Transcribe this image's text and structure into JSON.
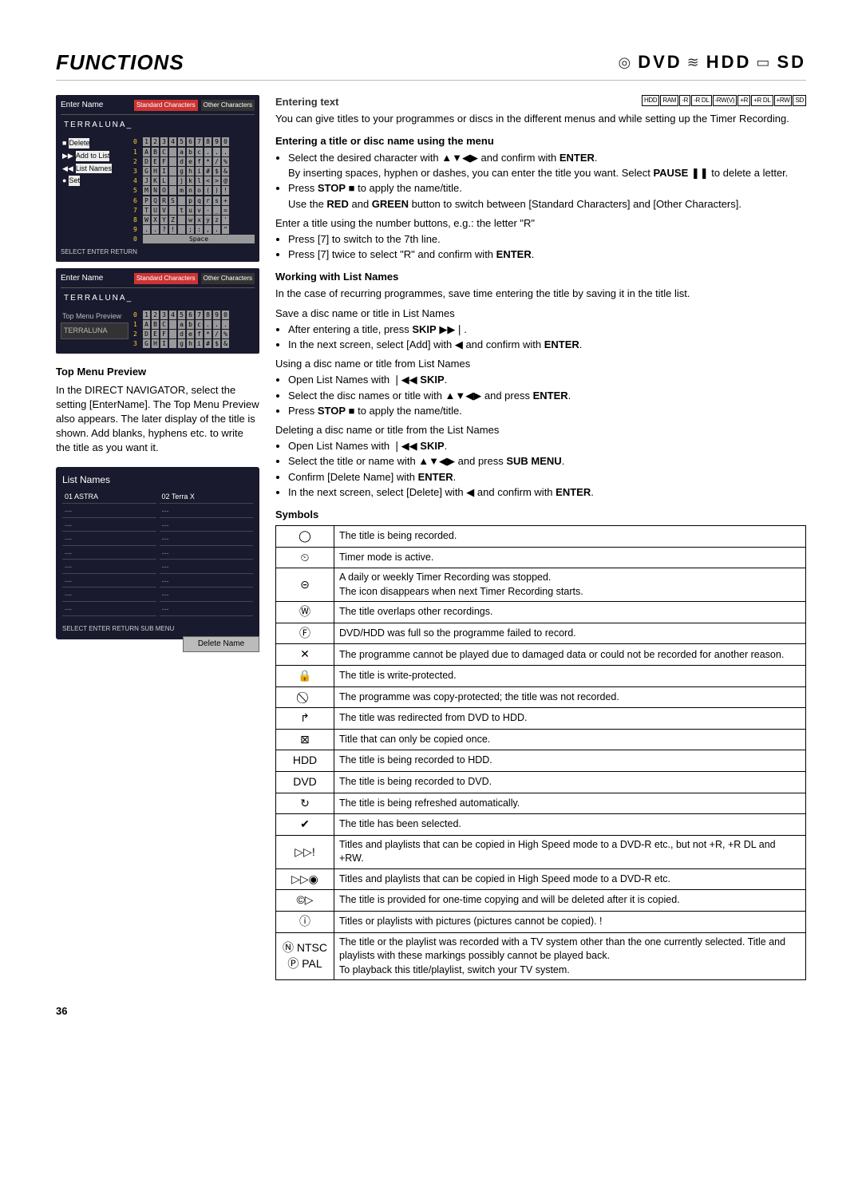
{
  "header": {
    "title": "FUNCTIONS",
    "media": [
      "DVD",
      "HDD",
      "SD"
    ]
  },
  "osd1": {
    "title": "Enter Name",
    "tab1": "Standard Characters",
    "tab2": "Other Characters",
    "sub": "TERRALUNA_",
    "menu": [
      "Delete",
      "Add to List",
      "List Names",
      "Set"
    ],
    "foot": "SELECT   ENTER   RETURN",
    "space": "Space"
  },
  "osd2": {
    "title": "Enter Name",
    "tab1": "Standard Characters",
    "tab2": "Other Characters",
    "sub": "TERRALUNA_",
    "pvlabel": "Top Menu Preview",
    "pv": "TERRALUNA"
  },
  "tmp_h": "Top Menu Preview",
  "tmp_p": "In the DIRECT NAVIGATOR, select the setting [EnterName]. The Top Menu Preview also appears. The later display of the title is shown. Add blanks, hyphens etc. to write the title as you want it.",
  "list": {
    "title": "List Names",
    "items": [
      "01 ASTRA",
      "02 Terra X",
      "---",
      "---",
      "---",
      "---",
      "---",
      "---",
      "---",
      "---",
      "---",
      "---",
      "---",
      "---",
      "---",
      "---",
      "---",
      "---"
    ],
    "foot": "SELECT   ENTER   RETURN   SUB MENU",
    "del": "Delete Name"
  },
  "r_head": "Entering text",
  "formats": [
    "HDD",
    "RAM",
    "-R",
    "-R DL",
    "-RW(V)",
    "+R",
    "+R DL",
    "+RW",
    "SD"
  ],
  "intro": "You can give titles to your programmes or discs in the different menus and while setting up the Timer Recording.",
  "s1_h": "Entering a title or disc name using the menu",
  "s1": [
    "Select the desired character with ▲▼◀▶ and confirm with ENTER.",
    "By inserting spaces, hyphen or dashes, you can enter the title you want. Select PAUSE ❚❚ to delete a letter.",
    "Press STOP ■ to apply the name/title.",
    "Use the RED and GREEN button to switch between [Standard Characters] and [Other Characters]."
  ],
  "s2_intro": "Enter a title using the number buttons, e.g.: the letter \"R\"",
  "s2": [
    "Press [7] to switch to the 7th line.",
    "Press [7] twice to select \"R\" and confirm with ENTER."
  ],
  "s3_h": "Working with List Names",
  "s3_intro": "In the case of recurring programmes, save time entering the title by saving it in the title list.",
  "s3a_h": "Save a disc name or title in List Names",
  "s3a": [
    "After entering a title, press SKIP ▶▶❘.",
    "In the next screen, select [Add] with ◀ and confirm with ENTER."
  ],
  "s3b_h": "Using a disc name or title from List Names",
  "s3b": [
    "Open List Names with ❘◀◀ SKIP.",
    "Select the disc names or title with ▲▼◀▶ and press ENTER.",
    "Press STOP ■ to apply the name/title."
  ],
  "s3c_h": "Deleting a disc name or title from the List Names",
  "s3c": [
    "Open List Names with ❘◀◀ SKIP.",
    "Select the title or name with ▲▼◀▶ and press SUB MENU.",
    "Confirm [Delete Name] with ENTER.",
    "In the next screen, select [Delete] with ◀ and confirm with ENTER."
  ],
  "sym_h": "Symbols",
  "symbols": [
    {
      "i": "◯",
      "t": "The title is being recorded."
    },
    {
      "i": "⏲",
      "t": "Timer mode is active."
    },
    {
      "i": "⊝",
      "t": "A daily or weekly Timer Recording was stopped.\nThe icon disappears when next Timer Recording starts."
    },
    {
      "i": "Ⓦ",
      "t": "The title overlaps other recordings."
    },
    {
      "i": "Ⓕ",
      "t": "DVD/HDD was full so the programme failed to record."
    },
    {
      "i": "✕",
      "t": "The programme cannot be played due to damaged data or could not be recorded for another reason."
    },
    {
      "i": "🔒",
      "t": "The title is write-protected."
    },
    {
      "i": "⃠",
      "t": "The programme was copy-protected; the title was not recorded."
    },
    {
      "i": "↱",
      "t": "The title was redirected from DVD to HDD."
    },
    {
      "i": "⊠",
      "t": "Title that can only be copied once."
    },
    {
      "i": "HDD",
      "t": "The title is being recorded to HDD."
    },
    {
      "i": "DVD",
      "t": "The title is being recorded to DVD."
    },
    {
      "i": "↻",
      "t": "The title is being refreshed automatically."
    },
    {
      "i": "✔",
      "t": "The title has been selected."
    },
    {
      "i": "▷▷!",
      "t": "Titles and playlists that can be copied in High Speed mode to a DVD-R etc., but not +R, +R DL and +RW."
    },
    {
      "i": "▷▷◉",
      "t": "Titles and playlists that can be copied in High Speed mode to a DVD-R etc."
    },
    {
      "i": "©▷",
      "t": "The title is provided for one-time copying and will be deleted after it is copied."
    },
    {
      "i": "ⓘ",
      "t": "Titles or playlists with pictures (pictures cannot be copied). !"
    },
    {
      "i": "Ⓝ NTSC\nⓅ PAL",
      "t": "The title or the playlist was recorded with a TV system other than the one currently selected. Title and playlists with these markings possibly cannot be played back.\nTo playback this title/playlist, switch your TV system."
    }
  ],
  "pagenum": "36"
}
